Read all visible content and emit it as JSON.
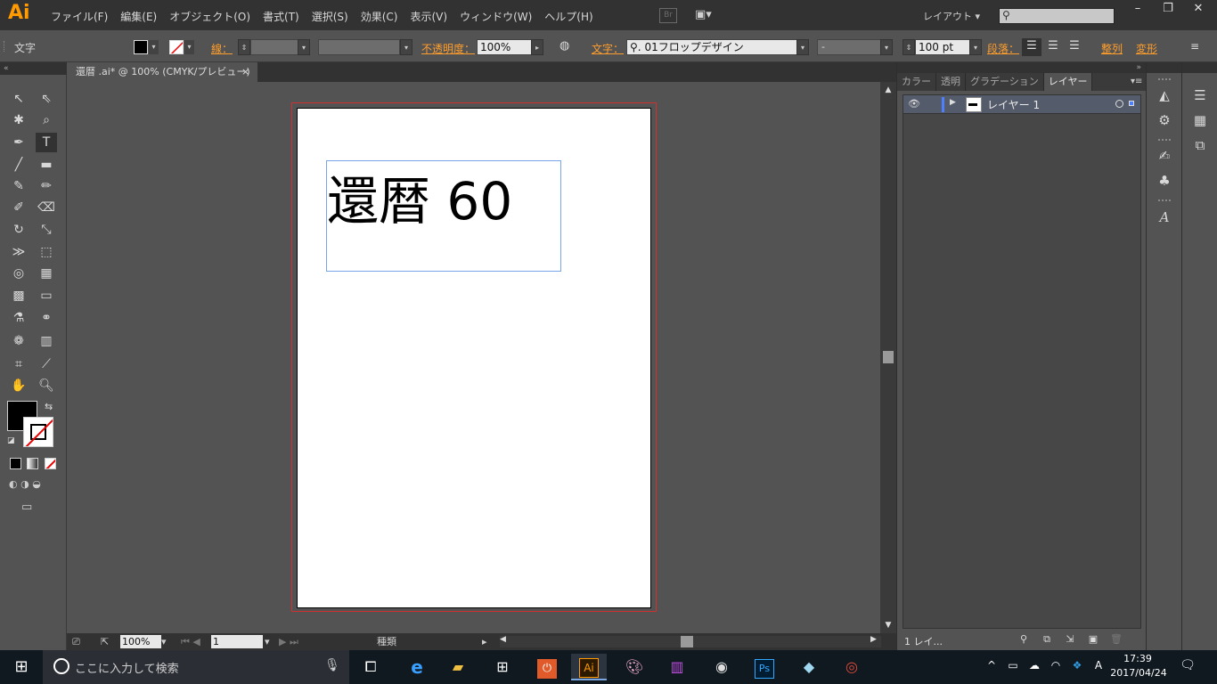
{
  "app": {
    "logo": "Ai",
    "menu": [
      "ファイル(F)",
      "編集(E)",
      "オブジェクト(O)",
      "書式(T)",
      "選択(S)",
      "効果(C)",
      "表示(V)",
      "ウィンドウ(W)",
      "ヘルプ(H)"
    ],
    "bridge_label": "Br",
    "workspace": "レイアウト",
    "window_controls": [
      "–",
      "❐",
      "✕"
    ]
  },
  "control_bar": {
    "object_type": "文字",
    "stroke_label": "線：",
    "opacity_label": "不透明度：",
    "opacity_value": "100%",
    "character_label": "文字：",
    "font_family": "01フロップデザイン",
    "font_style": "-",
    "font_size": "100 pt",
    "paragraph_label": "段落：",
    "align_label": "整列",
    "transform_label": "変形"
  },
  "document": {
    "tab_title": "還暦 .ai* @ 100% (CMYK/プレビュー)",
    "close": "×",
    "artboard_text": "還暦 60"
  },
  "status": {
    "zoom": "100%",
    "page": "1",
    "info": "種類"
  },
  "layers_panel": {
    "tabs": [
      "カラー",
      "透明",
      "グラデーション",
      "レイヤー"
    ],
    "active_tab": "レイヤー",
    "layers": [
      {
        "name": "レイヤー 1",
        "color": "#4f7fff"
      }
    ],
    "layer_count": "1 レイ..."
  },
  "taskbar": {
    "search_placeholder": "ここに入力して検索",
    "time": "17:39",
    "date": "2017/04/24",
    "ime": "A"
  },
  "colors": {
    "accent_orange": "#ff9e2c",
    "ai_logo": "#ff9a00",
    "bleed_red": "#d03030",
    "selection_blue": "#7aa4e8"
  }
}
